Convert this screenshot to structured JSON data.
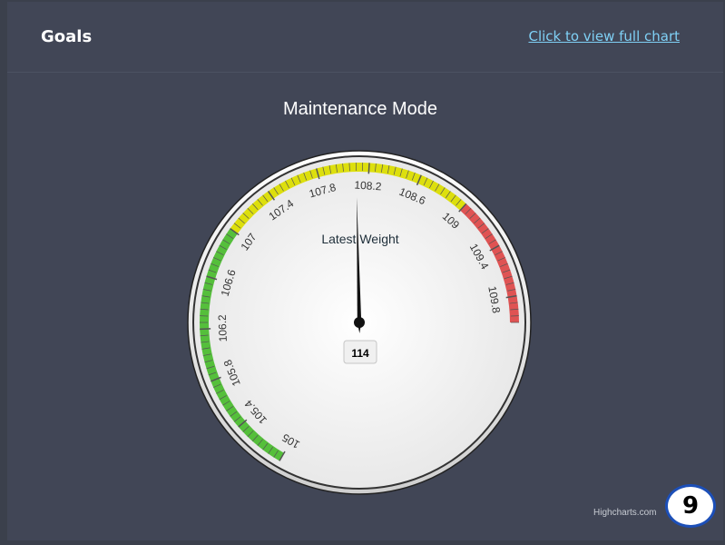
{
  "header": {
    "title": "Goals",
    "link_label": "Click to view full chart"
  },
  "chart_data": {
    "type": "gauge",
    "title": "Maintenance Mode",
    "pane_label": "Latest Weight",
    "value": 114,
    "value_label": "114",
    "needle_value": 108.1,
    "min": 105,
    "max": 110,
    "tick_labels": [
      "105",
      "105.4",
      "105.8",
      "106.2",
      "106.6",
      "107",
      "107.4",
      "107.8",
      "108.2",
      "108.6",
      "109",
      "109.4",
      "109.8"
    ],
    "bands": [
      {
        "from": 105,
        "to": 107,
        "color": "#55bf3b"
      },
      {
        "from": 107,
        "to": 109,
        "color": "#dddf0d"
      },
      {
        "from": 109,
        "to": 110,
        "color": "#df5353"
      }
    ]
  },
  "credits": "Highcharts.com",
  "badge": "9"
}
